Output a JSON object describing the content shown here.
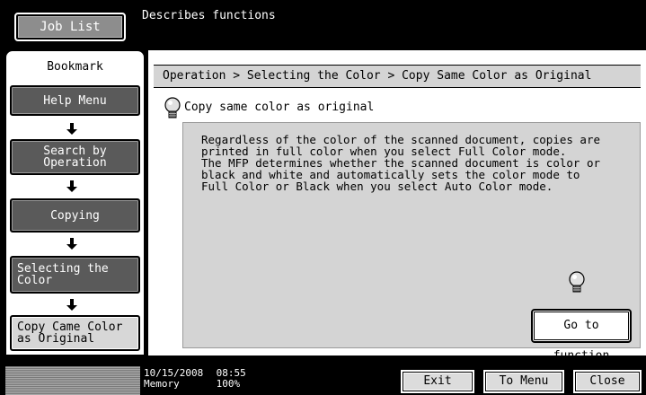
{
  "header": {
    "job_list_label": "Job List",
    "message": "Describes functions"
  },
  "sidebar": {
    "title": "Bookmark",
    "items": [
      {
        "label": "Help Menu"
      },
      {
        "label": "Search by\nOperation"
      },
      {
        "label": "Copying"
      },
      {
        "label": "Selecting the\nColor"
      },
      {
        "label": "Copy Came Color\nas Original"
      }
    ]
  },
  "main": {
    "breadcrumb": "Operation > Selecting the Color > Copy Same Color as Original",
    "heading": "Copy same color as original",
    "description": "Regardless of the color of the scanned document, copies are\nprinted in full color when you select Full Color mode.\nThe MFP determines whether the scanned document is color or\nblack and white and automatically sets the color mode to\nFull Color or Black when you select Auto Color mode.",
    "go_button": "Go to function"
  },
  "footer": {
    "date": "10/15/2008",
    "time": "08:55",
    "memory_label": "Memory",
    "memory_value": "100%",
    "exit_label": "Exit",
    "to_menu_label": "To Menu",
    "close_label": "Close"
  },
  "icons": [
    "lightbulb-icon",
    "down-arrow-icon"
  ]
}
